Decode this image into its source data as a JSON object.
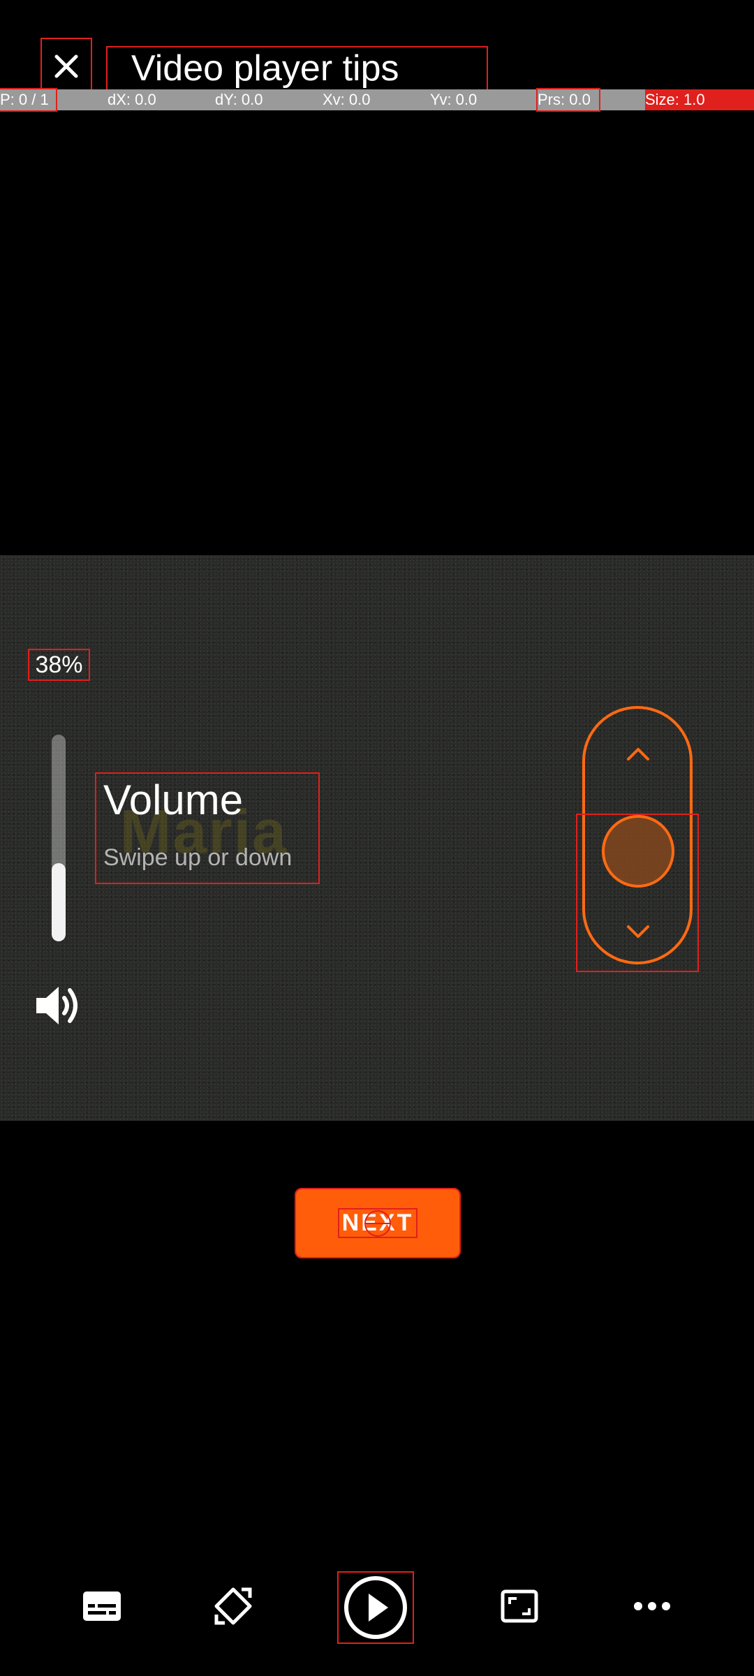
{
  "header": {
    "title": "Video player tips",
    "close_icon": "close-icon"
  },
  "pointer_bar": {
    "p": "P: 0 / 1",
    "dx": "dX: 0.0",
    "dy": "dY: 0.0",
    "xv": "Xv: 0.0",
    "yv": "Yv: 0.0",
    "prs": "Prs: 0.0",
    "size": "Size: 1.0"
  },
  "video": {
    "watermark": "Maria",
    "volume_percent_text": "38%",
    "volume_level": 0.38,
    "tip_title": "Volume",
    "tip_subtitle": "Swipe up or down"
  },
  "next_button": {
    "label": "NEXT"
  },
  "controls": [
    {
      "name": "subtitles-icon"
    },
    {
      "name": "rotate-icon"
    },
    {
      "name": "play-icon"
    },
    {
      "name": "aspect-ratio-icon"
    },
    {
      "name": "more-icon"
    }
  ],
  "colors": {
    "accent": "#ff5d0a",
    "debug": "#e0201c"
  }
}
